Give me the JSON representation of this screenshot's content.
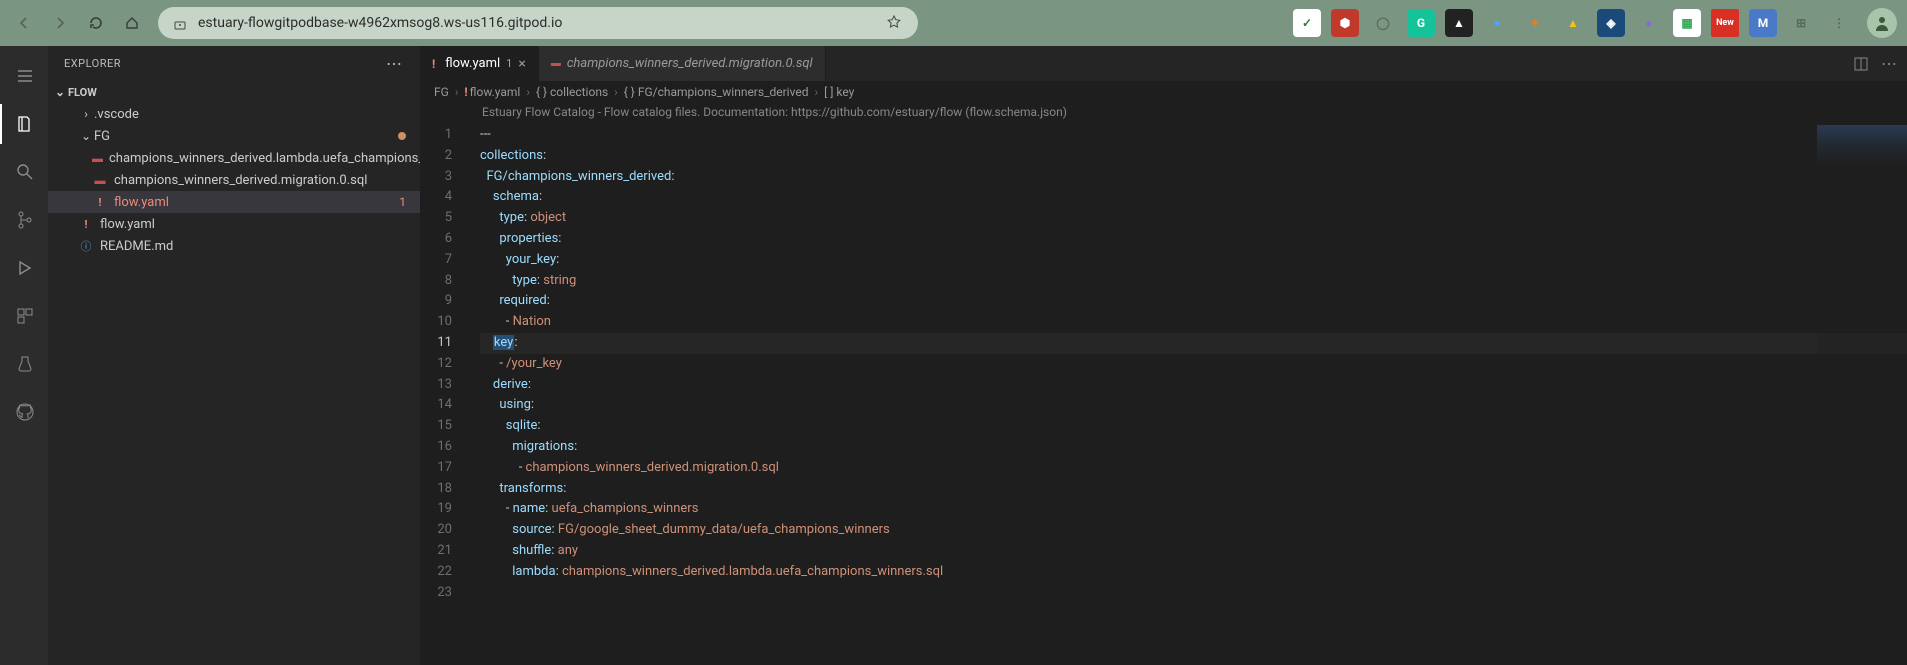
{
  "browser": {
    "url": "estuary-flowgitpodbase-w4962xmsog8.ws-us116.gitpod.io",
    "extensions": [
      {
        "name": "check",
        "bg": "#ffffff",
        "fg": "#2a7a3a",
        "txt": "✓"
      },
      {
        "name": "ublock",
        "bg": "#c0392b",
        "fg": "#fff",
        "txt": "⬢"
      },
      {
        "name": "sync",
        "bg": "transparent",
        "fg": "#5a6a5a",
        "txt": "◯"
      },
      {
        "name": "grammarly",
        "bg": "#15c39a",
        "fg": "#fff",
        "txt": "G"
      },
      {
        "name": "dark",
        "bg": "#222",
        "fg": "#fff",
        "txt": "▲"
      },
      {
        "name": "blue",
        "bg": "transparent",
        "fg": "#4aa3ff",
        "txt": "●"
      },
      {
        "name": "fox",
        "bg": "transparent",
        "fg": "#e67e22",
        "txt": "✦"
      },
      {
        "name": "drive",
        "bg": "transparent",
        "fg": "#f1c40f",
        "txt": "▲"
      },
      {
        "name": "arc",
        "bg": "#1a4a7a",
        "fg": "#fff",
        "txt": "◈"
      },
      {
        "name": "purple",
        "bg": "transparent",
        "fg": "#8a6adb",
        "txt": "●"
      },
      {
        "name": "sheet",
        "bg": "#fff",
        "fg": "#34a853",
        "txt": "▦"
      },
      {
        "name": "new",
        "bg": "#d93025",
        "fg": "#fff",
        "txt": "New"
      },
      {
        "name": "m",
        "bg": "#4a7ac7",
        "fg": "#fff",
        "txt": "M"
      },
      {
        "name": "ext",
        "bg": "transparent",
        "fg": "#5a6a5a",
        "txt": "⊞"
      },
      {
        "name": "menu",
        "bg": "transparent",
        "fg": "#5a6a5a",
        "txt": "⋮"
      }
    ]
  },
  "sidebar": {
    "title": "EXPLORER",
    "root": "FLOW",
    "tree": [
      {
        "type": "folder",
        "name": ".vscode",
        "depth": 1,
        "collapsed": true
      },
      {
        "type": "folder",
        "name": "FG",
        "depth": 1,
        "collapsed": false,
        "modified": true
      },
      {
        "type": "file",
        "name": "champions_winners_derived.lambda.uefa_champions_winners.sql",
        "depth": 2,
        "icon": "db"
      },
      {
        "type": "file",
        "name": "champions_winners_derived.migration.0.sql",
        "depth": 2,
        "icon": "db"
      },
      {
        "type": "file",
        "name": "flow.yaml",
        "depth": 2,
        "icon": "excl",
        "problem": true,
        "selected": true,
        "badge": "1"
      },
      {
        "type": "file",
        "name": "flow.yaml",
        "depth": 1,
        "icon": "excl"
      },
      {
        "type": "file",
        "name": "README.md",
        "depth": 1,
        "icon": "info"
      }
    ]
  },
  "tabs": [
    {
      "label": "flow.yaml",
      "icon": "excl",
      "problem": "1",
      "active": true
    },
    {
      "label": "champions_winners_derived.migration.0.sql",
      "icon": "db",
      "italic": true
    }
  ],
  "breadcrumbs": [
    "FG",
    "flow.yaml",
    "{ } collections",
    "{ } FG/champions_winners_derived",
    "[ ] key"
  ],
  "banner": "Estuary Flow Catalog - Flow catalog files. Documentation: https://github.com/estuary/flow (flow.schema.json)",
  "code": {
    "current_line": 11,
    "lines": [
      {
        "n": 1,
        "raw": "---"
      },
      {
        "n": 2,
        "raw": "collections:",
        "tokens": [
          [
            "collections",
            "c-prop"
          ],
          [
            ":",
            "c-punc"
          ]
        ]
      },
      {
        "n": 3,
        "raw": "  FG/champions_winners_derived:",
        "tokens": [
          [
            "  ",
            ""
          ],
          [
            "FG/champions_winners_derived",
            "c-prop"
          ],
          [
            ":",
            "c-punc"
          ]
        ]
      },
      {
        "n": 4,
        "raw": "    schema:",
        "tokens": [
          [
            "    ",
            ""
          ],
          [
            "schema",
            "c-prop"
          ],
          [
            ":",
            "c-punc"
          ]
        ]
      },
      {
        "n": 5,
        "raw": "      type: object",
        "tokens": [
          [
            "      ",
            ""
          ],
          [
            "type",
            "c-prop"
          ],
          [
            ": ",
            "c-punc"
          ],
          [
            "object",
            "c-str"
          ]
        ]
      },
      {
        "n": 6,
        "raw": "      properties:",
        "tokens": [
          [
            "      ",
            ""
          ],
          [
            "properties",
            "c-prop"
          ],
          [
            ":",
            "c-punc"
          ]
        ]
      },
      {
        "n": 7,
        "raw": "        your_key:",
        "tokens": [
          [
            "        ",
            ""
          ],
          [
            "your_key",
            "c-prop"
          ],
          [
            ":",
            "c-punc"
          ]
        ]
      },
      {
        "n": 8,
        "raw": "          type: string",
        "tokens": [
          [
            "          ",
            ""
          ],
          [
            "type",
            "c-prop"
          ],
          [
            ": ",
            "c-punc"
          ],
          [
            "string",
            "c-str"
          ]
        ]
      },
      {
        "n": 9,
        "raw": "      required:",
        "tokens": [
          [
            "      ",
            ""
          ],
          [
            "required",
            "c-prop"
          ],
          [
            ":",
            "c-punc"
          ]
        ]
      },
      {
        "n": 10,
        "raw": "        - Nation",
        "tokens": [
          [
            "        - ",
            ""
          ],
          [
            "Nation",
            "c-str"
          ]
        ]
      },
      {
        "n": 11,
        "raw": "    key:",
        "tokens": [
          [
            "    ",
            ""
          ],
          [
            "key",
            "c-prop",
            "sel"
          ],
          [
            ":",
            "c-punc"
          ]
        ]
      },
      {
        "n": 12,
        "raw": "      - /your_key",
        "tokens": [
          [
            "      - ",
            ""
          ],
          [
            "/your_key",
            "c-str"
          ]
        ]
      },
      {
        "n": 13,
        "raw": "    derive:",
        "tokens": [
          [
            "    ",
            ""
          ],
          [
            "derive",
            "c-prop"
          ],
          [
            ":",
            "c-punc"
          ]
        ]
      },
      {
        "n": 14,
        "raw": "      using:",
        "tokens": [
          [
            "      ",
            ""
          ],
          [
            "using",
            "c-prop"
          ],
          [
            ":",
            "c-punc"
          ]
        ]
      },
      {
        "n": 15,
        "raw": "        sqlite:",
        "tokens": [
          [
            "        ",
            ""
          ],
          [
            "sqlite",
            "c-prop"
          ],
          [
            ":",
            "c-punc"
          ]
        ]
      },
      {
        "n": 16,
        "raw": "          migrations:",
        "tokens": [
          [
            "          ",
            ""
          ],
          [
            "migrations",
            "c-prop"
          ],
          [
            ":",
            "c-punc"
          ]
        ]
      },
      {
        "n": 17,
        "raw": "            - champions_winners_derived.migration.0.sql",
        "tokens": [
          [
            "            - ",
            ""
          ],
          [
            "champions_winners_derived.migration.0.sql",
            "c-str"
          ]
        ]
      },
      {
        "n": 18,
        "raw": "      transforms:",
        "tokens": [
          [
            "      ",
            ""
          ],
          [
            "transforms",
            "c-prop"
          ],
          [
            ":",
            "c-punc"
          ]
        ]
      },
      {
        "n": 19,
        "raw": "        - name: uefa_champions_winners",
        "tokens": [
          [
            "        - ",
            ""
          ],
          [
            "name",
            "c-prop"
          ],
          [
            ": ",
            "c-punc"
          ],
          [
            "uefa_champions_winners",
            "c-str"
          ]
        ]
      },
      {
        "n": 20,
        "raw": "          source: FG/google_sheet_dummy_data/uefa_champions_winners",
        "tokens": [
          [
            "          ",
            ""
          ],
          [
            "source",
            "c-prop"
          ],
          [
            ": ",
            "c-punc"
          ],
          [
            "FG/google_sheet_dummy_data/uefa_champions_winners",
            "c-str"
          ]
        ]
      },
      {
        "n": 21,
        "raw": "          shuffle: any",
        "tokens": [
          [
            "          ",
            ""
          ],
          [
            "shuffle",
            "c-prop"
          ],
          [
            ": ",
            "c-punc"
          ],
          [
            "any",
            "c-str"
          ]
        ]
      },
      {
        "n": 22,
        "raw": "          lambda: champions_winners_derived.lambda.uefa_champions_winners.sql",
        "tokens": [
          [
            "          ",
            ""
          ],
          [
            "lambda",
            "c-prop"
          ],
          [
            ": ",
            "c-punc"
          ],
          [
            "champions_winners_derived.lambda.uefa_champions_winners.sql",
            "c-str"
          ]
        ]
      },
      {
        "n": 23,
        "raw": ""
      }
    ]
  }
}
